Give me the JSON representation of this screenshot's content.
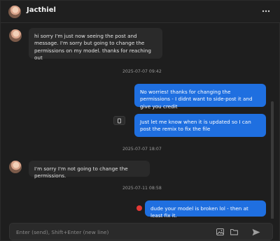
{
  "header": {
    "title": "Jacthiel",
    "more_icon": "more-horizontal-icon"
  },
  "messages": [
    {
      "direction": "in",
      "text": "hi sorry I'm just now seeing the post and message. I'm sorry but going to change the permissions on my model. thanks for reaching out"
    },
    {
      "direction": "timestamp",
      "text": "2025-07-07 09:42"
    },
    {
      "direction": "out",
      "text": "No worries! thanks for changing the permissions - I didnt want to side-post it and give you credit"
    },
    {
      "direction": "out",
      "text": "Just let me know when it is updated so I can post the remix to fix the file",
      "copy_icon": "copy-icon"
    },
    {
      "direction": "timestamp",
      "text": "2025-07-07 18:07"
    },
    {
      "direction": "in",
      "text": "I'm sorry I'm not going to change the permissions."
    },
    {
      "direction": "timestamp",
      "text": "2025-07-11 08:58"
    },
    {
      "direction": "out",
      "text": "dude your model is broken lol - then at least fix it.",
      "status_icon": "error-icon"
    }
  ],
  "composer": {
    "placeholder": "Enter (send), Shift+Enter (new line)",
    "value": "",
    "image_icon": "image-icon",
    "folder_icon": "folder-icon",
    "send_icon": "send-icon"
  },
  "colors": {
    "outgoing_bubble": "#1f6fe0",
    "incoming_bubble": "#2a2a2a",
    "error": "#e53935"
  }
}
